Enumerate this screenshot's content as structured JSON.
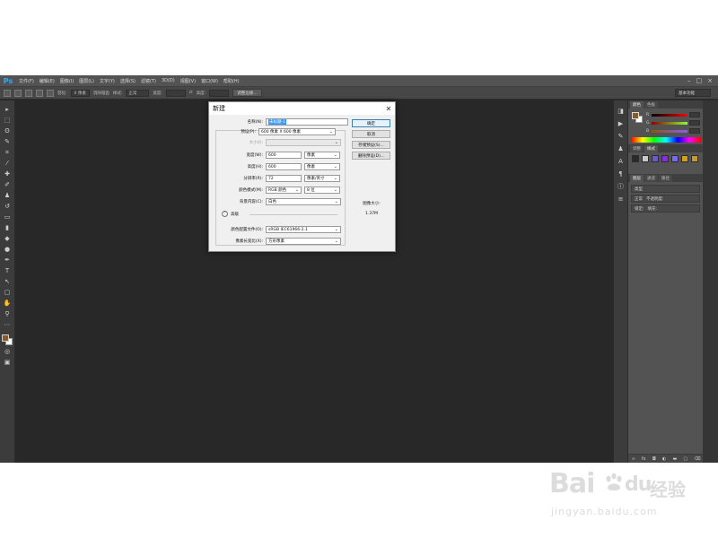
{
  "app": {
    "logo": "Ps",
    "menu": [
      "文件(F)",
      "编辑(E)",
      "图像(I)",
      "图层(L)",
      "文字(Y)",
      "选择(S)",
      "滤镜(T)",
      "3D(D)",
      "视图(V)",
      "窗口(W)",
      "帮助(H)"
    ],
    "window_controls": [
      "–",
      "□",
      "×"
    ]
  },
  "options_bar": {
    "feather_label": "羽化:",
    "feather_value": "0 像素",
    "antialias_label": "消除锯齿",
    "style_label": "样式:",
    "style_value": "正常",
    "width_label": "宽度:",
    "height_label": "高度:",
    "refine_edge": "调整边缘...",
    "workspace": "基本功能"
  },
  "panels": {
    "color_tabs": [
      "颜色",
      "色板"
    ],
    "color_channels": [
      "R",
      "G",
      "B"
    ],
    "styles_tabs": [
      "调整",
      "样式"
    ],
    "layers_tabs": [
      "图层",
      "通道",
      "路径"
    ],
    "layer_kind": "类型",
    "blend_mode": "正常",
    "opacity_label": "不透明度:",
    "lock_label": "锁定:",
    "fill_label": "填充:",
    "footer_icons": [
      "link-icon",
      "fx-icon",
      "mask-icon",
      "adjust-icon",
      "folder-icon",
      "new-layer-icon",
      "trash-icon"
    ]
  },
  "dialog": {
    "title": "新建",
    "name_label": "名称(N):",
    "name_value": "未标题-1",
    "preset_label": "预设(P):",
    "preset_value": "600 像素 X 600 像素",
    "size_label": "大小(I):",
    "width_label": "宽度(W):",
    "width_value": "600",
    "width_unit": "像素",
    "height_label": "高度(H):",
    "height_value": "600",
    "height_unit": "像素",
    "resolution_label": "分辨率(R):",
    "resolution_value": "72",
    "resolution_unit": "像素/英寸",
    "color_mode_label": "颜色模式(M):",
    "color_mode_value": "RGB 颜色",
    "bit_depth": "8 位",
    "background_label": "背景内容(C):",
    "background_value": "白色",
    "advanced_label": "高级",
    "profile_label": "颜色配置文件(O):",
    "profile_value": "sRGB IEC61966-2.1",
    "pixel_aspect_label": "像素长宽比(X):",
    "pixel_aspect_value": "方形像素",
    "ok": "确定",
    "cancel": "取消",
    "save_preset": "存储预设(S)...",
    "delete_preset": "删除预设(D)...",
    "image_size_label": "图像大小:",
    "image_size_value": "1.37M"
  },
  "watermark": {
    "brand": "Bai",
    "brand2": "du",
    "cn": "经验",
    "url": "jingyan.baidu.com"
  }
}
